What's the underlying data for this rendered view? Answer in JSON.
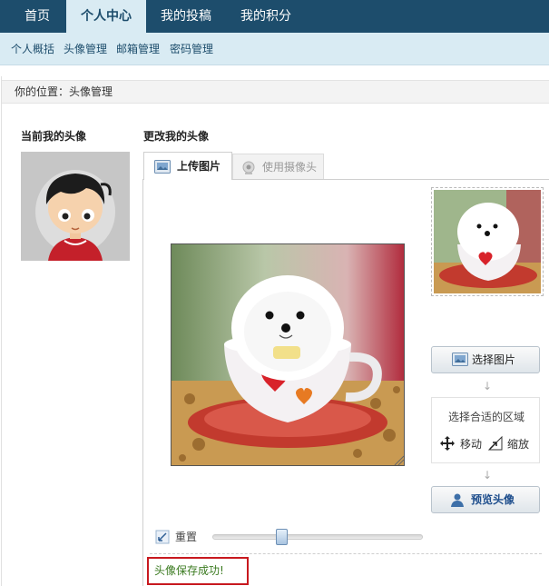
{
  "nav": {
    "tabs": [
      {
        "label": "首页",
        "active": false
      },
      {
        "label": "个人中心",
        "active": true
      },
      {
        "label": "我的投稿",
        "active": false
      },
      {
        "label": "我的积分",
        "active": false
      }
    ]
  },
  "subnav": {
    "items": [
      "个人概括",
      "头像管理",
      "邮箱管理",
      "密码管理"
    ]
  },
  "breadcrumb": "你的位置：头像管理",
  "current_avatar": {
    "title": "当前我的头像"
  },
  "change_avatar": {
    "title": "更改我的头像",
    "tabs": {
      "upload": "上传图片",
      "camera": "使用摄像头"
    }
  },
  "actions": {
    "select_image": "选择图片",
    "region_title": "选择合适的区域",
    "move": "移动",
    "zoom": "缩放",
    "preview": "预览头像",
    "arrow": "↓"
  },
  "slider": {
    "reset_label": "重置",
    "value": 0.33
  },
  "status": {
    "message": "头像保存成功!"
  },
  "colors": {
    "nav_bg": "#1d4d6c",
    "subnav_bg": "#d9ebf3",
    "success_border": "#c8191f",
    "success_text": "#3a7a1f"
  }
}
